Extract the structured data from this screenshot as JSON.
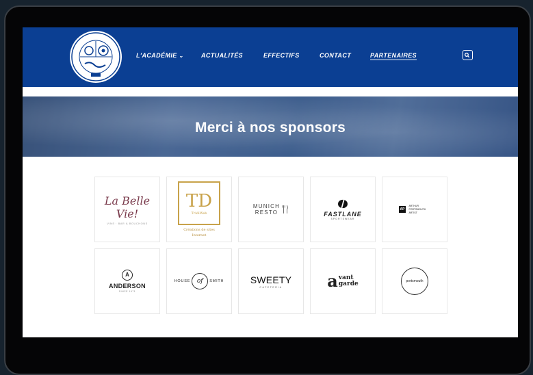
{
  "nav": {
    "logo_text": "ACADÉMIE DU GARDIEN DE BUT · GRAND SUD",
    "items": [
      {
        "label": "L'ACADÉMIE",
        "has_dropdown": true
      },
      {
        "label": "ACTUALITÉS"
      },
      {
        "label": "EFFECTIFS"
      },
      {
        "label": "CONTACT"
      },
      {
        "label": "PARTENAIRES",
        "active": true
      }
    ],
    "chevron": "⌄",
    "search_icon": "search-icon"
  },
  "hero": {
    "title": "Merci à nos sponsors"
  },
  "sponsors": [
    {
      "line1": "La Belle Vie!",
      "line2": "VINS · BAR À BOUCHONS"
    },
    {
      "line1": "TD",
      "line2": "TridiWeb",
      "line3": "Créations de sites Internet"
    },
    {
      "line1": "MUNICH",
      "line2": "RESTO"
    },
    {
      "line1": "FASTLANE",
      "line2": "SPORTSWEAR"
    },
    {
      "line1": "AP",
      "line2": "ARTHUR PORTSMOUTH ARTIST"
    },
    {
      "line1": "A",
      "line2": "ANDERSON",
      "line3": "SINCE 1971"
    },
    {
      "line1": "HOUSE",
      "line2": "of",
      "line3": "SMITH"
    },
    {
      "line1": "SWEETY",
      "line2": "CAFETERIA"
    },
    {
      "line1": "a",
      "line2": "vant",
      "line3": "garde"
    },
    {
      "line1": "portsmouth"
    }
  ],
  "colors": {
    "nav_bg": "#0b3f93",
    "accent": "#c8a24a",
    "page_bg": "#17232e"
  }
}
